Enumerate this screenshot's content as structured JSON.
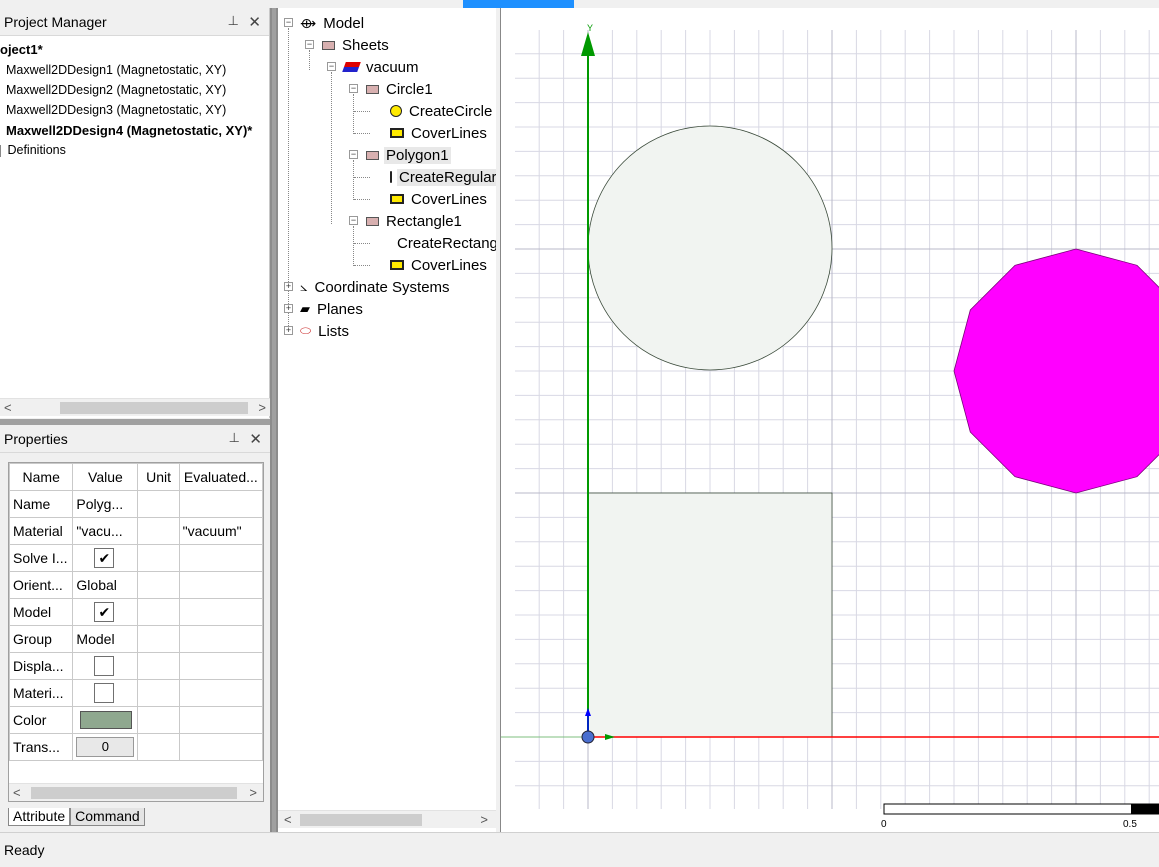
{
  "project_manager": {
    "title": "Project Manager",
    "project": "oject1*",
    "designs": [
      "Maxwell2DDesign1 (Magnetostatic, XY)",
      "Maxwell2DDesign2 (Magnetostatic, XY)",
      "Maxwell2DDesign3 (Magnetostatic, XY)",
      "Maxwell2DDesign4 (Magnetostatic, XY)*"
    ],
    "definitions": "Definitions"
  },
  "properties": {
    "title": "Properties",
    "columns": [
      "Name",
      "Value",
      "Unit",
      "Evaluated..."
    ],
    "rows": {
      "name": {
        "label": "Name",
        "value": "Polyg..."
      },
      "material": {
        "label": "Material",
        "value": "\"vacu...",
        "evaluated": "\"vacuum\""
      },
      "solve_inside": {
        "label": "Solve I...",
        "checked": true
      },
      "orientation": {
        "label": "Orient...",
        "value": "Global"
      },
      "model": {
        "label": "Model",
        "checked": true
      },
      "group": {
        "label": "Group",
        "value": "Model"
      },
      "display_wireframe": {
        "label": "Displa...",
        "checked": false
      },
      "material_appearance": {
        "label": "Materi...",
        "checked": false
      },
      "color": {
        "label": "Color",
        "value": "#8fa88f"
      },
      "transparency": {
        "label": "Trans...",
        "value": "0"
      }
    },
    "tabs": [
      "Attribute",
      "Command"
    ]
  },
  "tree": {
    "model": "Model",
    "sheets": "Sheets",
    "vacuum": "vacuum",
    "circle1": "Circle1",
    "create_circle": "CreateCircle",
    "coverlines_1": "CoverLines",
    "polygon1": "Polygon1",
    "create_regular": "CreateRegularPolygon",
    "coverlines_2": "CoverLines",
    "rectangle1": "Rectangle1",
    "create_rect": "CreateRectangle",
    "coverlines_3": "CoverLines",
    "coordinate_systems": "Coordinate Systems",
    "planes": "Planes",
    "lists": "Lists"
  },
  "viewport": {
    "y_axis_label": "Y",
    "scale_start": "0",
    "scale_mid": "0.5",
    "colors": {
      "polygon": "#ff00ff",
      "x_axis": "#ff0000",
      "y_axis": "#009900",
      "z_axis": "#0000ff",
      "grid": "#d8d8e4",
      "shape_fill": "#f1f4f1"
    }
  },
  "status": {
    "text": "Ready"
  }
}
